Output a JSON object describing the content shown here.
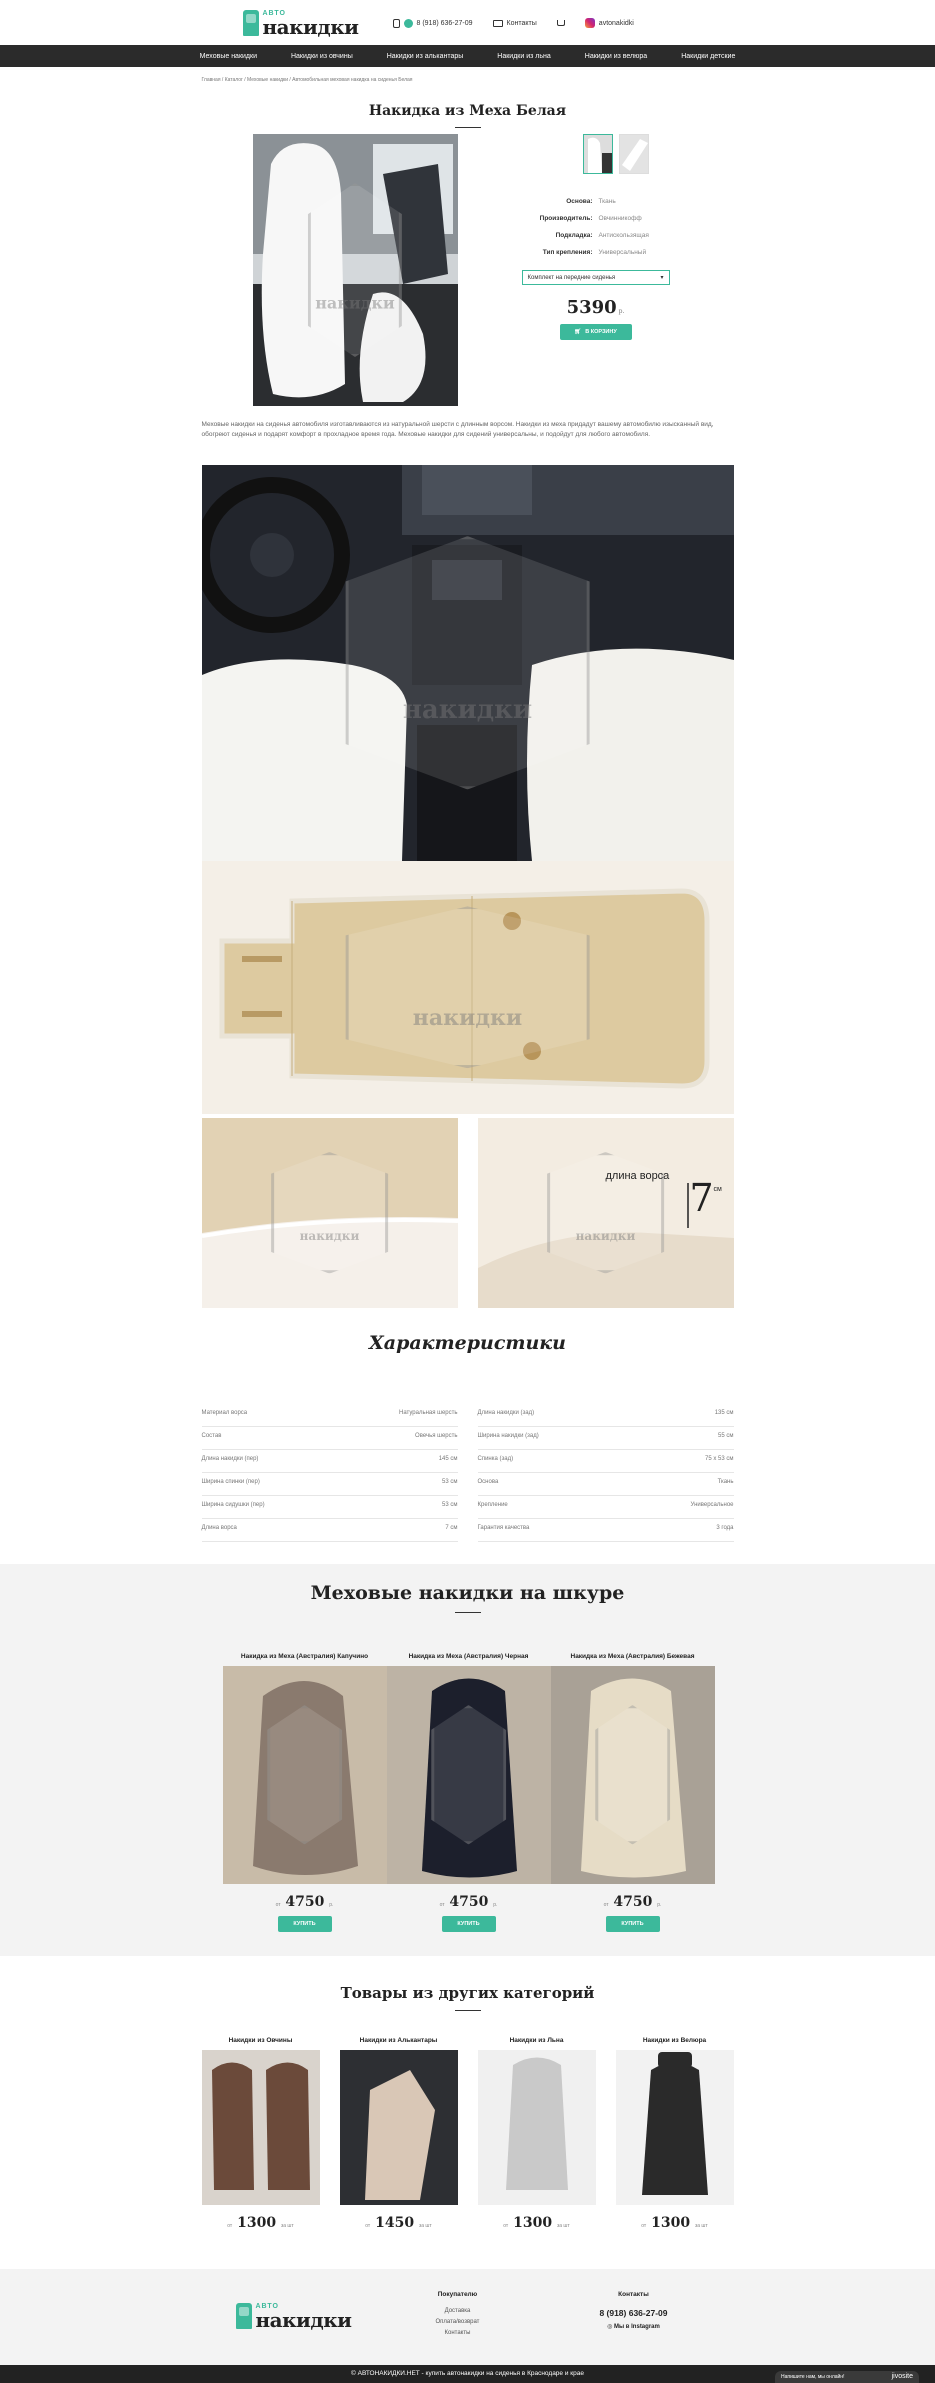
{
  "header": {
    "logo_small": "АВТО",
    "logo_big": "накидки",
    "phone": "8 (918) 636-27-09",
    "contacts_label": "Контакты",
    "instagram_label": "avtonakidki"
  },
  "nav": [
    "Меховые накидки",
    "Накидки из овчины",
    "Накидки из алькантары",
    "Накидки из льна",
    "Накидки из велюра",
    "Накидки детские"
  ],
  "breadcrumb": "Главная / Каталог / Меховые накидки / Автомобильная меховая накидка на сиденья Белая",
  "product": {
    "title": "Накидка из Меха Белая",
    "specs": [
      {
        "key": "Основа:",
        "value": "Ткань"
      },
      {
        "key": "Производитель:",
        "value": "Овчинникофф"
      },
      {
        "key": "Подкладка:",
        "value": "Антискользящая"
      },
      {
        "key": "Тип крепления:",
        "value": "Универсальный"
      }
    ],
    "select_value": "Комплект на передние сиденья",
    "price": "5390",
    "currency": "р.",
    "cart_button": "В корзину",
    "description": "Меховые накидки на сиденья автомобиля изготавливаются из натуральной шерсти с длинным ворсом. Накидки из меха придадут вашему автомобилю изысканный вид, обогреют сиденья и подарят комфорт в прохладное время года. Меховые накидки для сидений универсальны, и подойдут для любого автомобиля."
  },
  "photos": {
    "pile_label": "длина ворса",
    "pile_value": "7",
    "pile_unit": "см",
    "watermark": "накидки"
  },
  "characteristics": {
    "title": "Характеристики",
    "left": [
      {
        "k": "Материал ворса",
        "v": "Натуральная шерсть"
      },
      {
        "k": "Состав",
        "v": "Овечья шерсть"
      },
      {
        "k": "Длина накидки (пер)",
        "v": "145 см"
      },
      {
        "k": "Ширина спинки (пер)",
        "v": "53 см"
      },
      {
        "k": "Ширина сидушки (пер)",
        "v": "53 см"
      },
      {
        "k": "Длина ворса",
        "v": "7 см"
      }
    ],
    "right": [
      {
        "k": "Длина накидки (зад)",
        "v": "135 см"
      },
      {
        "k": "Ширина накидки (зад)",
        "v": "55 см"
      },
      {
        "k": "Спинка (зад)",
        "v": "75 x 53 см"
      },
      {
        "k": "Основа",
        "v": "Ткань"
      },
      {
        "k": "Крепление",
        "v": "Универсальное"
      },
      {
        "k": "Гарантия качества",
        "v": "3 года"
      }
    ]
  },
  "fur_section": {
    "title": "Меховые накидки на шкуре",
    "items": [
      {
        "name": "Накидка из Меха (Австралия) Капучино",
        "from": "от",
        "price": "4750",
        "currency": "р.",
        "button": "Купить",
        "color": "#8a7a6e"
      },
      {
        "name": "Накидка из Меха (Австралия) Черная",
        "from": "от",
        "price": "4750",
        "currency": "р.",
        "button": "Купить",
        "color": "#1c1f2c"
      },
      {
        "name": "Накидка из Меха (Австралия) Бежевая",
        "from": "от",
        "price": "4750",
        "currency": "р.",
        "button": "Купить",
        "color": "#e6dcc6"
      }
    ]
  },
  "other_section": {
    "title": "Товары из других категорий",
    "items": [
      {
        "name": "Накидки из Овчины",
        "from": "от",
        "price": "1300",
        "unit": "за шт",
        "color": "#6b4a3a"
      },
      {
        "name": "Накидки из Алькантары",
        "from": "от",
        "price": "1450",
        "unit": "за шт",
        "color": "#d9c7b6"
      },
      {
        "name": "Накидки из Льна",
        "from": "от",
        "price": "1300",
        "unit": "за шт",
        "color": "#c9c9c9"
      },
      {
        "name": "Накидки из Велюра",
        "from": "от",
        "price": "1300",
        "unit": "за шт",
        "color": "#2a2a2a"
      }
    ]
  },
  "footer": {
    "buyers_title": "Покупателю",
    "buyers_links": [
      "Доставка",
      "Oплата/возврат",
      "Контакты"
    ],
    "contacts_title": "Контакты",
    "phone": "8 (918) 636-27-09",
    "instagram": "Мы в Instagram",
    "copyright": "© АВТОНАКИДКИ.НЕТ - купить автонакидки на сиденья в Краснодаре и крае",
    "chat_label": "Напишите нам, мы онлайн!",
    "chat_brand": "jivosite"
  },
  "colors": {
    "accent": "#3cb99b",
    "nav_bg": "#2b2b2b"
  }
}
